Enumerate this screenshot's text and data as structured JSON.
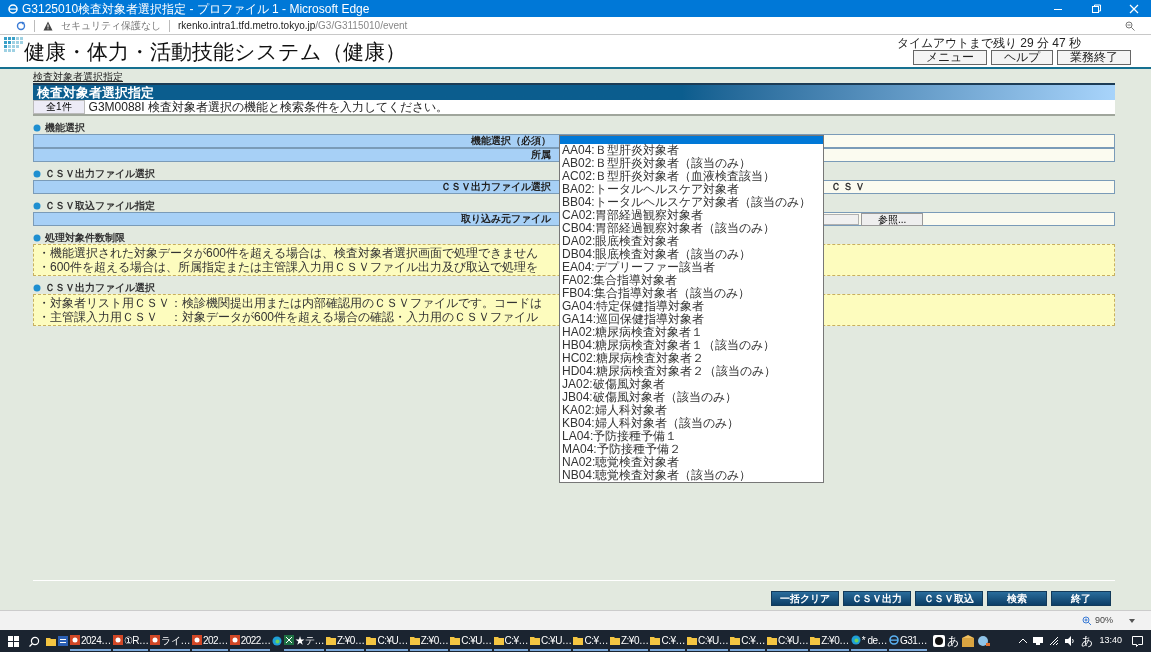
{
  "window": {
    "title": "G3125010検査対象者選択指定 - プロファイル 1 - Microsoft Edge"
  },
  "address_bar": {
    "security": "セキュリティ保護なし",
    "url_host": "rkenko.intra1.tfd.metro.tokyo.jp",
    "url_path": "/G3/G3115010/event"
  },
  "header": {
    "title": "健康・体力・活動技能システム（健康）",
    "timeout": "タイムアウトまで残り 29 分 47 秒",
    "buttons": [
      "メニュー",
      "ヘルプ",
      "業務終了"
    ]
  },
  "breadcrumb": "検査対象者選択指定",
  "page_title": "検査対象者選択指定",
  "message": {
    "count": "全1件",
    "text": "G3M0088I 検査対象者選択の機能と検索条件を入力してください。"
  },
  "sections": [
    {
      "title": "機能選択",
      "kind": "rows",
      "rows": [
        {
          "label": "機能選択（必須）",
          "kind": "select_open"
        },
        {
          "label": "所属",
          "kind": "empty"
        }
      ]
    },
    {
      "title": "ＣＳＶ出力ファイル選択",
      "kind": "rows",
      "rows": [
        {
          "label": "ＣＳＶ出力ファイル選択",
          "kind": "value",
          "value": "ＣＳＶ"
        }
      ]
    },
    {
      "title": "ＣＳＶ取込ファイル指定",
      "kind": "rows",
      "rows": [
        {
          "label": "取り込み元ファイル",
          "kind": "file",
          "button": "参照..."
        }
      ]
    },
    {
      "title": "処理対象件数制限",
      "kind": "notes",
      "notes": [
        "・機能選択された対象データが600件を超える場合は、検査対象者選択画面で処理できません",
        "・600件を超える場合は、所属指定または主管課入力用ＣＳＶファイル出力及び取込で処理を"
      ]
    },
    {
      "title": "ＣＳＶ出力ファイル選択",
      "kind": "notes",
      "notes": [
        "・対象者リスト用ＣＳＶ：検診機関提出用または内部確認用のＣＳＶファイルです。コードは",
        "・主管課入力用ＣＳＶ　：対象データが600件を超える場合の確認・入力用のＣＳＶファイル"
      ]
    }
  ],
  "dropdown": {
    "blank_option_highlighted": true,
    "options": [
      "AA04:Ｂ型肝炎対象者",
      "AB02:Ｂ型肝炎対象者（該当のみ）",
      "AC02:Ｂ型肝炎対象者（血液検査該当）",
      "BA02:トータルヘルスケア対象者",
      "BB04:トータルヘルスケア対象者（該当のみ）",
      "CA02:胃部経過観察対象者",
      "CB04:胃部経過観察対象者（該当のみ）",
      "DA02:眼底検査対象者",
      "DB04:眼底検査対象者（該当のみ）",
      "EA04:デプリーファー該当者",
      "FA02:集合指導対象者",
      "FB04:集合指導対象者（該当のみ）",
      "GA04:特定保健指導対象者",
      "GA14:巡回保健指導対象者",
      "HA02:糖尿病検査対象者１",
      "HB04:糖尿病検査対象者１（該当のみ）",
      "HC02:糖尿病検査対象者２",
      "HD04:糖尿病検査対象者２（該当のみ）",
      "JA02:破傷風対象者",
      "JB04:破傷風対象者（該当のみ）",
      "KA02:婦人科対象者",
      "KB04:婦人科対象者（該当のみ）",
      "LA04:予防接種予備１",
      "MA04:予防接種予備２",
      "NA02:聴覚検査対象者",
      "NB04:聴覚検査対象者（該当のみ）"
    ]
  },
  "buttons": [
    "一括クリア",
    "ＣＳＶ出力",
    "ＣＳＶ取込",
    "検索",
    "終了"
  ],
  "status_bar": {
    "zoom": "90%"
  },
  "taskbar": {
    "items": [
      {
        "kind": "folder"
      },
      {
        "kind": "word"
      },
      {
        "kind": "ppt",
        "label": "2024…"
      },
      {
        "kind": "ppt",
        "label": "①R…"
      },
      {
        "kind": "ppt",
        "label": "ライ…"
      },
      {
        "kind": "ppt",
        "label": "202…"
      },
      {
        "kind": "ppt",
        "label": "2022…"
      },
      {
        "kind": "edge"
      },
      {
        "kind": "excel",
        "label": "★テ…"
      },
      {
        "kind": "folder",
        "label": "Z:¥0…"
      },
      {
        "kind": "folder",
        "label": "C:¥U…"
      },
      {
        "kind": "folder",
        "label": "Z:¥0…"
      },
      {
        "kind": "folder",
        "label": "C:¥U…"
      },
      {
        "kind": "folder",
        "label": "C:¥…"
      },
      {
        "kind": "folder",
        "label": "C:¥U…"
      },
      {
        "kind": "folder",
        "label": "C:¥…"
      },
      {
        "kind": "folder",
        "label": "Z:¥0…"
      },
      {
        "kind": "folder",
        "label": "C:¥…"
      },
      {
        "kind": "folder",
        "label": "C:¥U…"
      },
      {
        "kind": "folder",
        "label": "C:¥…"
      },
      {
        "kind": "folder",
        "label": "C:¥U…"
      },
      {
        "kind": "folder",
        "label": "Z:¥0…"
      },
      {
        "kind": "edge",
        "label": "* de…"
      },
      {
        "kind": "ie",
        "label": "G31…"
      }
    ],
    "ime": "あ",
    "tray_ime": "あ",
    "clock": "13:40"
  }
}
